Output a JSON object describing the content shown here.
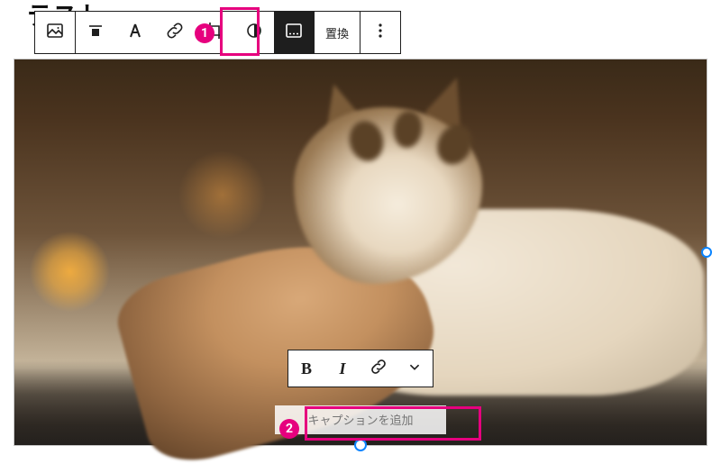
{
  "peek_text": "テスト",
  "toolbar": {
    "replace_label": "置換",
    "icons": {
      "block_type": "image-block-icon",
      "align": "align-icon",
      "text_overlay": "text-overlay-icon",
      "link": "link-icon",
      "crop": "crop-icon",
      "duotone": "duotone-icon",
      "caption": "caption-toggle-icon",
      "more": "more-icon"
    }
  },
  "inline_toolbar": {
    "bold_glyph": "B",
    "italic_glyph": "I",
    "link_icon": "link-icon",
    "chevron_icon": "chevron-down-icon"
  },
  "caption": {
    "placeholder": "キャプションを追加",
    "value": ""
  },
  "annotations": {
    "badge1": "1",
    "badge2": "2"
  }
}
